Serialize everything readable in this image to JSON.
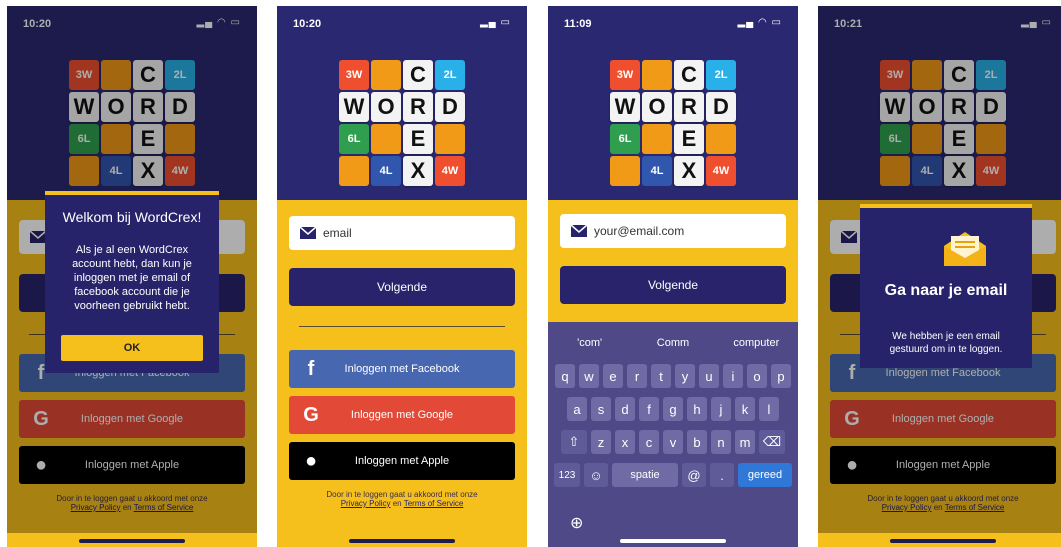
{
  "colors": {
    "navy": "#2a2871",
    "yellow": "#f6c01c",
    "facebook": "#4767b0",
    "google": "#e24937",
    "apple": "#000000",
    "tile_orange": "#f09a17",
    "tile_red": "#ef4f2e",
    "tile_cyan": "#2ab0e8",
    "tile_green": "#2f9f4f",
    "tile_blue": "#3156ad"
  },
  "icons": [
    "wifi-icon",
    "signal-icon",
    "battery-icon",
    "mail-icon",
    "facebook-icon",
    "google-icon",
    "apple-icon",
    "globe-icon",
    "shift-icon",
    "backspace-icon",
    "emoji-icon"
  ],
  "logo": {
    "letters": {
      "w": "W",
      "o": "O",
      "r": "R",
      "d": "D",
      "c": "C",
      "e": "E",
      "x": "X"
    },
    "tiles": {
      "3w": "3W",
      "2l": "2L",
      "6l": "6L",
      "4l": "4L",
      "4w": "4W"
    }
  },
  "screen1": {
    "time": "10:20",
    "modal_title": "Welkom bij WordCrex!",
    "modal_text": "Als je al een WordCrex account hebt, dan kun je inloggen met je email of facebook account die je voorheen gebruikt hebt.",
    "ok_label": "OK",
    "facebook_label": "Inloggen met Facebook",
    "google_label": "Inloggen met Google",
    "apple_label": "Inloggen met Apple"
  },
  "screen2": {
    "time": "10:20",
    "email_placeholder": "email",
    "next_label": "Volgende",
    "facebook_label": "Inloggen met Facebook",
    "google_label": "Inloggen met Google",
    "apple_label": "Inloggen met Apple"
  },
  "screen3": {
    "time": "11:09",
    "email_placeholder": "your@email.com",
    "next_label": "Volgende",
    "suggestions": [
      "'com'",
      "Comm",
      "computer"
    ],
    "row1": [
      "q",
      "w",
      "e",
      "r",
      "t",
      "y",
      "u",
      "i",
      "o",
      "p"
    ],
    "row2": [
      "a",
      "s",
      "d",
      "f",
      "g",
      "h",
      "j",
      "k",
      "l"
    ],
    "row3": [
      "z",
      "x",
      "c",
      "v",
      "b",
      "n",
      "m"
    ],
    "num_label": "123",
    "space_label": "spatie",
    "at_label": "@",
    "dot_label": ".",
    "go_label": "gereed"
  },
  "screen4": {
    "time": "10:21",
    "modal_title": "Ga naar je email",
    "modal_text": "We hebben je een email gestuurd om in te loggen.",
    "facebook_label": "Inloggen met Facebook",
    "google_label": "Inloggen met Google",
    "apple_label": "Inloggen met Apple"
  },
  "legal": {
    "line1": "Door in te loggen gaat u akkoord met onze",
    "privacy": "Privacy Policy",
    "and": "en",
    "terms": "Terms of Service"
  }
}
